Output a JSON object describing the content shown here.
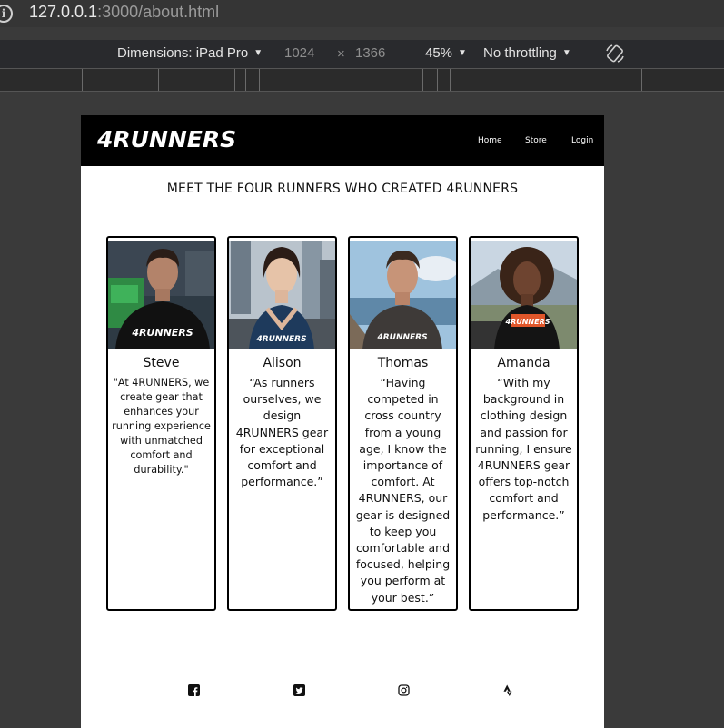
{
  "browser": {
    "url_host": "127.0.0.1",
    "url_rest": ":3000/about.html",
    "dimensions_label": "Dimensions: iPad Pro",
    "width": "1024",
    "times": "×",
    "height": "1366",
    "zoom": "45%",
    "throttling": "No throttling"
  },
  "site": {
    "logo": "4RUNNERS",
    "nav": [
      "Home",
      "Store",
      "Login"
    ],
    "title": "MEET THE FOUR RUNNERS WHO CREATED 4RUNNERS",
    "runners": [
      {
        "name": "Steve",
        "quote": "\"At 4RUNNERS, we create gear that enhances your running experience with unmatched comfort and durability.\""
      },
      {
        "name": "Alison",
        "quote": "“As runners ourselves, we design 4RUNNERS gear for exceptional comfort and performance.”"
      },
      {
        "name": "Thomas",
        "quote": "“Having competed in cross country from a young age, I know the importance of comfort. At 4RUNNERS, our gear is designed to keep you comfortable and focused, helping you perform at your best.”"
      },
      {
        "name": "Amanda",
        "quote": "“With my background in clothing design and passion for running, I ensure 4RUNNERS gear offers top-notch comfort and performance.”"
      }
    ],
    "shirt_text": "4RUNNERS",
    "social_icons": [
      "facebook-icon",
      "twitter-icon",
      "instagram-icon",
      "strava-icon"
    ]
  },
  "colors": {
    "header_bg": "#000000",
    "page_bg": "#ffffff",
    "devtools_bg": "#3a3a3a"
  }
}
